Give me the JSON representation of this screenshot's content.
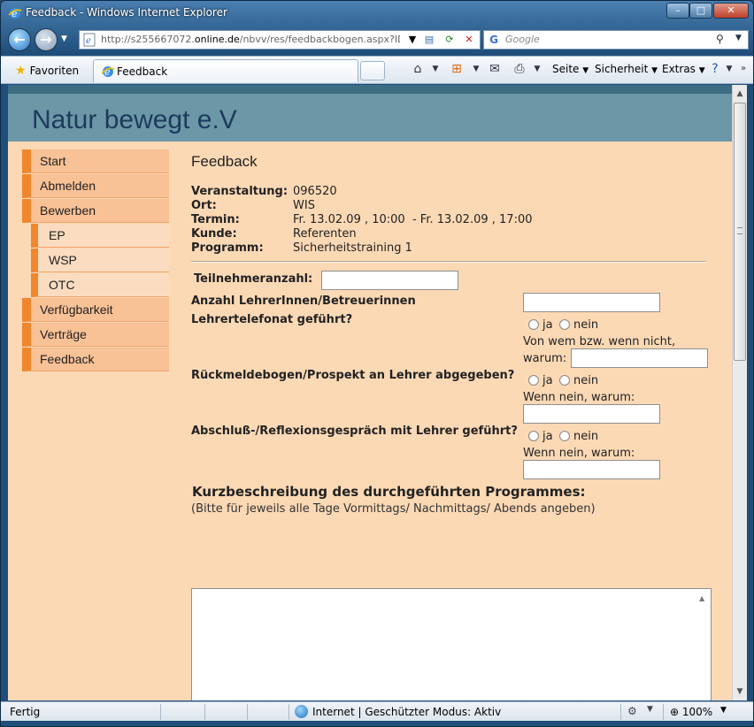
{
  "window": {
    "title": "Feedback - Windows Internet Explorer",
    "buttons": {
      "min": "–",
      "max": "□",
      "close": "✕"
    }
  },
  "address_bar": {
    "url_prefix": "http://s255667072.",
    "url_domain": "online.de",
    "url_rest": "/nbvv/res/feedbackbogen.aspx?ID=",
    "search_placeholder": "Google"
  },
  "command_bar": {
    "favorites_label": "Favoriten",
    "tab_title": "Feedback",
    "page_label": "Seite",
    "security_label": "Sicherheit",
    "extras_label": "Extras"
  },
  "site": {
    "title": "Natur bewegt e.V"
  },
  "menu": {
    "items": [
      {
        "label": "Start"
      },
      {
        "label": "Abmelden"
      },
      {
        "label": "Bewerben"
      },
      {
        "label": "EP"
      },
      {
        "label": "WSP"
      },
      {
        "label": "OTC"
      },
      {
        "label": "Verfügbarkeit"
      },
      {
        "label": "Verträge"
      },
      {
        "label": "Feedback"
      }
    ]
  },
  "feedback": {
    "heading": "Feedback",
    "info": [
      {
        "key": "Veranstaltung:",
        "value": "096520"
      },
      {
        "key": "Ort:",
        "value": "WIS"
      },
      {
        "key": "Termin:",
        "value": "Fr. 13.02.09 , 10:00  - Fr. 13.02.09 , 17:00"
      },
      {
        "key": "Kunde:",
        "value": "Referenten"
      },
      {
        "key": "Programm:",
        "value": "Sicherheitstraining 1"
      }
    ],
    "teilnehmer_label": "Teilnehmeranzahl:",
    "lehrer_anzahl_label": "Anzahl LehrerInnen/Betreuerinnen",
    "q1_label": "Lehrertelefonat geführt?",
    "q1_reason_label_1": "Von wem bzw. wenn nicht,",
    "q1_reason_label_2": "warum:",
    "q2_label": "Rückmeldebogen/Prospekt an Lehrer abgegeben?",
    "q2_reason_label": "Wenn nein, warum:",
    "q3_label": "Abschluß-/Reflexionsgespräch mit Lehrer geführt?",
    "q3_reason_label": "Wenn nein, warum:",
    "yes_label": "ja",
    "no_label": "nein",
    "description_heading": "Kurzbeschreibung des durchgeführten Programmes:",
    "description_hint": "(Bitte für jeweils alle Tage Vormittags/ Nachmittags/ Abends angeben)"
  },
  "status_bar": {
    "status": "Fertig",
    "zone": "Internet | Geschützter Modus: Aktiv",
    "zoom": "100%"
  }
}
